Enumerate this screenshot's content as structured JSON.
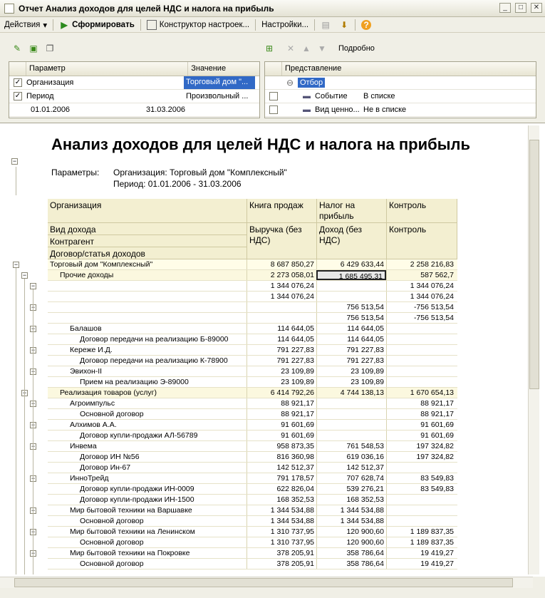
{
  "window": {
    "title": "Отчет  Анализ доходов для целей НДС и налога на прибыль",
    "buttons": [
      "_",
      "□",
      "✕"
    ]
  },
  "toolbar": {
    "actions": "Действия",
    "generate": "Сформировать",
    "constructor": "Конструктор настроек...",
    "settings": "Настройки..."
  },
  "paramtoolbar": {
    "detail": "Подробно"
  },
  "params": {
    "col_param": "Параметр",
    "col_value": "Значение",
    "rows": [
      {
        "checked": true,
        "name": "Организация",
        "value": "Торговый дом \"..."
      },
      {
        "checked": true,
        "name": "Период",
        "value": "Произвольный ..."
      }
    ],
    "period_from": "01.01.2006",
    "period_to": "31.03.2006"
  },
  "view": {
    "col": "Представление",
    "filter": "Отбор",
    "rows": [
      {
        "name": "Событие",
        "cond": "В списке"
      },
      {
        "name": "Вид ценно...",
        "cond": "Не в списке"
      }
    ]
  },
  "report": {
    "title": "Анализ доходов для целей НДС и налога на прибыль",
    "params_label": "Параметры:",
    "org_line": "Организация: Торговый дом \"Комплексный\"",
    "period_line": "Период: 01.01.2006 - 31.03.2006",
    "headers": {
      "h_org": "Организация",
      "h_book": "Книга продаж",
      "h_tax": "Налог на прибыль",
      "h_ctrl": "Контроль",
      "h_kind": "Вид дохода",
      "h_contr": "Контрагент",
      "h_contract": "Договор/статья доходов",
      "h_rev": "Выручка (без НДС)",
      "h_inc": "Доход (без НДС)",
      "h_ctrl2": "Контроль"
    },
    "rows": [
      {
        "l": 0,
        "n": "Торговый дом \"Комплексный\"",
        "a": "8 687 850,27",
        "b": "6 429 633,44",
        "c": "2 258 216,83"
      },
      {
        "l": 1,
        "n": "Прочие доходы",
        "a": "2 273 058,01",
        "b": "1 685 495,31",
        "c": "587 562,7"
      },
      {
        "l": 2,
        "n": "",
        "a": "1 344 076,24",
        "b": "",
        "c": "1 344 076,24"
      },
      {
        "l": 3,
        "n": "",
        "a": "1 344 076,24",
        "b": "",
        "c": "1 344 076,24"
      },
      {
        "l": 2,
        "n": "",
        "a": "",
        "b": "756 513,54",
        "c": "-756 513,54"
      },
      {
        "l": 3,
        "n": "",
        "a": "",
        "b": "756 513,54",
        "c": "-756 513,54"
      },
      {
        "l": 2,
        "n": "Балашов",
        "a": "114 644,05",
        "b": "114 644,05",
        "c": ""
      },
      {
        "l": 3,
        "n": "Договор передачи на реализацию Б-89000",
        "a": "114 644,05",
        "b": "114 644,05",
        "c": ""
      },
      {
        "l": 2,
        "n": "Кереже И.Д.",
        "a": "791 227,83",
        "b": "791 227,83",
        "c": ""
      },
      {
        "l": 3,
        "n": "Договор передачи на реализацию К-78900",
        "a": "791 227,83",
        "b": "791 227,83",
        "c": ""
      },
      {
        "l": 2,
        "n": "Эвихон-II",
        "a": "23 109,89",
        "b": "23 109,89",
        "c": ""
      },
      {
        "l": 3,
        "n": "Прием на реализацию Э-89000",
        "a": "23 109,89",
        "b": "23 109,89",
        "c": ""
      },
      {
        "l": 1,
        "n": "Реализация товаров (услуг)",
        "a": "6 414 792,26",
        "b": "4 744 138,13",
        "c": "1 670 654,13"
      },
      {
        "l": 2,
        "n": "Агроимпульс",
        "a": "88 921,17",
        "b": "",
        "c": "88 921,17"
      },
      {
        "l": 3,
        "n": "Основной договор",
        "a": "88 921,17",
        "b": "",
        "c": "88 921,17"
      },
      {
        "l": 2,
        "n": "Алхимов А.А.",
        "a": "91 601,69",
        "b": "",
        "c": "91 601,69"
      },
      {
        "l": 3,
        "n": "Договор купли-продажи АЛ-56789",
        "a": "91 601,69",
        "b": "",
        "c": "91 601,69"
      },
      {
        "l": 2,
        "n": "Инвема",
        "a": "958 873,35",
        "b": "761 548,53",
        "c": "197 324,82"
      },
      {
        "l": 3,
        "n": "Договор ИН №56",
        "a": "816 360,98",
        "b": "619 036,16",
        "c": "197 324,82"
      },
      {
        "l": 3,
        "n": "Договор Ин-67",
        "a": "142 512,37",
        "b": "142 512,37",
        "c": ""
      },
      {
        "l": 2,
        "n": "ИнноТрейд",
        "a": "791 178,57",
        "b": "707 628,74",
        "c": "83 549,83"
      },
      {
        "l": 3,
        "n": "Договор купли-продажи ИН-0009",
        "a": "622 826,04",
        "b": "539 276,21",
        "c": "83 549,83"
      },
      {
        "l": 3,
        "n": "Договор купли-продажи ИН-1500",
        "a": "168 352,53",
        "b": "168 352,53",
        "c": ""
      },
      {
        "l": 2,
        "n": "Мир бытовой техники на Варшавке",
        "a": "1 344 534,88",
        "b": "1 344 534,88",
        "c": ""
      },
      {
        "l": 3,
        "n": "Основной договор",
        "a": "1 344 534,88",
        "b": "1 344 534,88",
        "c": ""
      },
      {
        "l": 2,
        "n": "Мир бытовой техники на Ленинском",
        "a": "1 310 737,95",
        "b": "120 900,60",
        "c": "1 189 837,35"
      },
      {
        "l": 3,
        "n": "Основной договор",
        "a": "1 310 737,95",
        "b": "120 900,60",
        "c": "1 189 837,35"
      },
      {
        "l": 2,
        "n": "Мир бытовой техники на Покровке",
        "a": "378 205,91",
        "b": "358 786,64",
        "c": "19 419,27"
      },
      {
        "l": 3,
        "n": "Основной договор",
        "a": "378 205,91",
        "b": "358 786,64",
        "c": "19 419,27"
      }
    ]
  }
}
